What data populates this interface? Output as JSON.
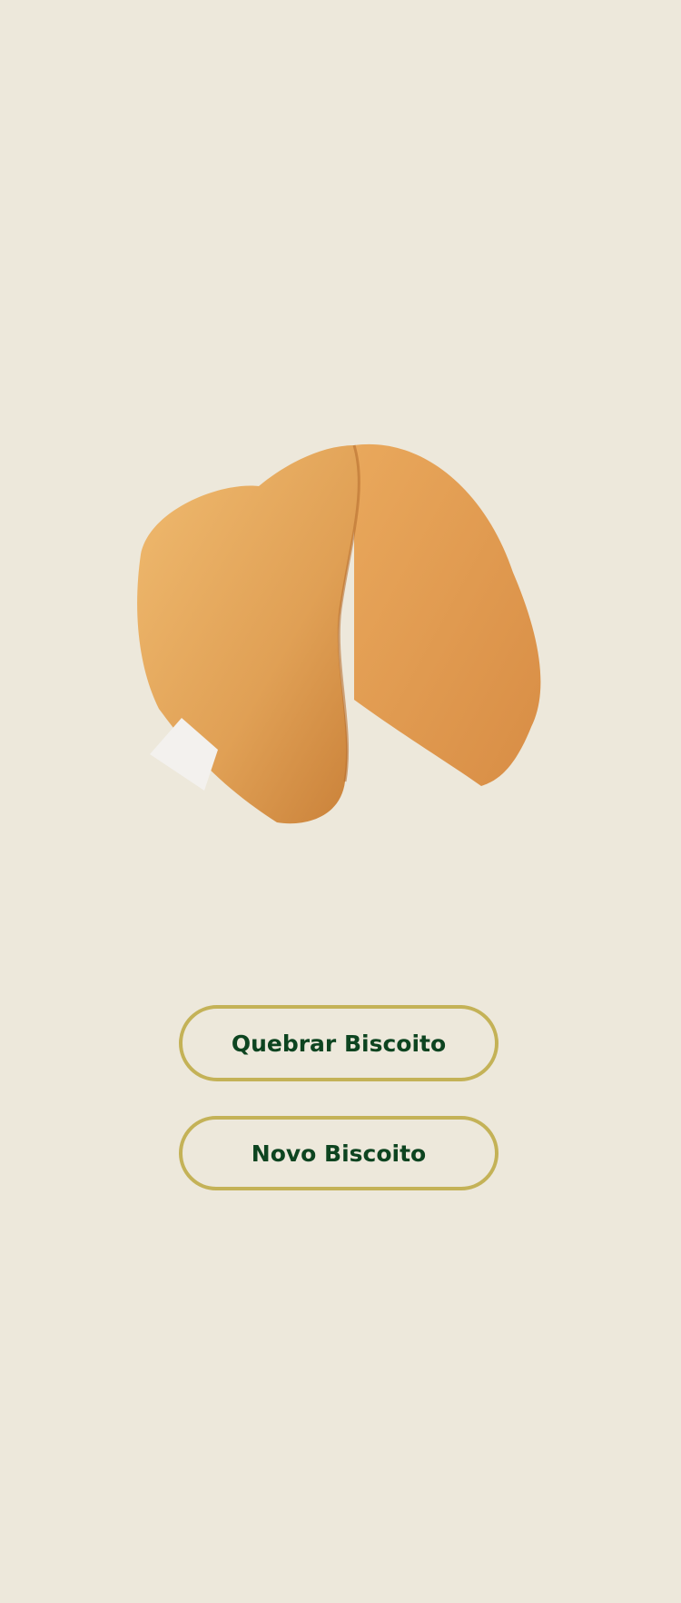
{
  "image": {
    "icon": "fortune-cookie-image"
  },
  "buttons": {
    "break_label": "Quebrar Biscoito",
    "new_label": "Novo Biscoito"
  },
  "colors": {
    "background": "#ede8db",
    "button_border": "#c4b257",
    "button_text": "#0d4420"
  }
}
